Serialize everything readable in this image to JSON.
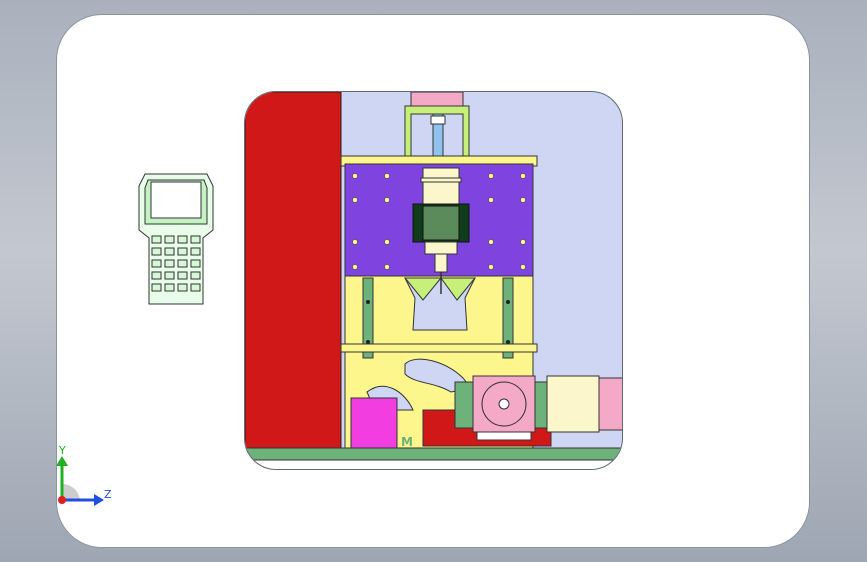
{
  "viewport": {
    "background": "#ffffff",
    "border_color": "#8c94a0"
  },
  "model": {
    "colors": {
      "red_panel": "#d01818",
      "purple_plate": "#7f44e0",
      "yellow_frame": "#fdf68c",
      "green_rails": "#6db27a",
      "magenta_block": "#f23ee0",
      "pink_motor": "#f4a9c6",
      "cream_box": "#fbf6cc",
      "light_blue_bg": "#cfd6f4"
    },
    "marking_text": "M"
  },
  "pendant": {
    "icon": "teach-pendant-icon",
    "color": "#c3f2c3"
  },
  "triad": {
    "y_label": "Y",
    "z_label": "Z",
    "y_color": "#22b022",
    "z_color": "#1f4fe0",
    "x_color": "#e02020"
  }
}
